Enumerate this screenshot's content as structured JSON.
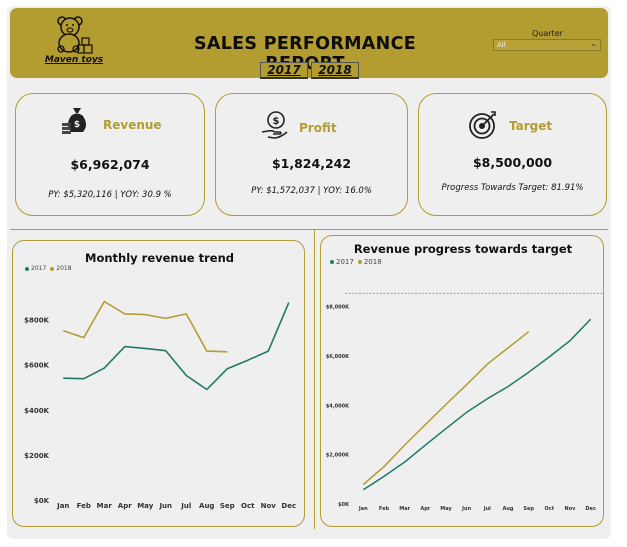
{
  "header": {
    "brand": "Maven toys",
    "title": "SALES PERFORMANCE REPORT",
    "years": [
      "2017",
      "2018"
    ],
    "quarter_label": "Quarter",
    "quarter_value": "All"
  },
  "colors": {
    "gold": "#b39c30",
    "teal": "#1f7a68",
    "background": "#efefef"
  },
  "kpis": {
    "revenue": {
      "label": "Revenue",
      "value": "$6,962,074",
      "footer": "PY: $5,320,116 | YOY: 30.9 %",
      "icon": "money-bag-icon"
    },
    "profit": {
      "label": "Profit",
      "value": "$1,824,242",
      "footer": "PY: $1,572,037  | YOY: 16.0%",
      "icon": "hand-dollar-icon"
    },
    "target": {
      "label": "Target",
      "value": "$8,500,000",
      "footer": "Progress Towards Target: 81.91%",
      "icon": "target-icon"
    }
  },
  "chart_data": [
    {
      "type": "line",
      "title": "Monthly revenue trend",
      "categories": [
        "Jan",
        "Feb",
        "Mar",
        "Apr",
        "May",
        "Jun",
        "Jul",
        "Aug",
        "Sep",
        "Oct",
        "Nov",
        "Dec"
      ],
      "y_ticks": [
        "$0K",
        "$200K",
        "$400K",
        "$600K",
        "$800K"
      ],
      "ylim": [
        0,
        900000
      ],
      "legend_position": "top-left",
      "series": [
        {
          "name": "2017",
          "color": "#1f7a68",
          "values": [
            540000,
            538000,
            585000,
            680000,
            672000,
            662000,
            552000,
            490000,
            582000,
            620000,
            660000,
            875000
          ]
        },
        {
          "name": "2018",
          "color": "#b39c30",
          "values": [
            750000,
            720000,
            880000,
            825000,
            822000,
            805000,
            825000,
            660000,
            657000,
            null,
            null,
            null
          ]
        }
      ]
    },
    {
      "type": "line",
      "title": "Revenue progress towards target",
      "categories": [
        "Jan",
        "Feb",
        "Mar",
        "Apr",
        "May",
        "Jun",
        "Jul",
        "Aug",
        "Sep",
        "Oct",
        "Nov",
        "Dec"
      ],
      "y_ticks": [
        "$0K",
        "$2,000K",
        "$4,000K",
        "$6,000K",
        "$8,000K"
      ],
      "ylim": [
        0,
        9000000
      ],
      "target_line": 8500000,
      "legend_position": "top-left",
      "series": [
        {
          "name": "2017",
          "color": "#1f7a68",
          "values": [
            540000,
            1078000,
            1663000,
            2343000,
            3015000,
            3677000,
            4229000,
            4719000,
            5301000,
            5921000,
            6581000,
            7456000
          ]
        },
        {
          "name": "2018",
          "color": "#b39c30",
          "values": [
            750000,
            1470000,
            2350000,
            3175000,
            3997000,
            4802000,
            5627000,
            6287000,
            6944000,
            null,
            null,
            null
          ]
        }
      ]
    }
  ]
}
